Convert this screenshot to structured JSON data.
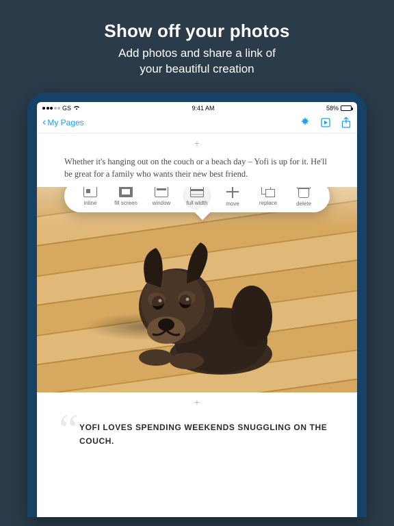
{
  "promo": {
    "title": "Show off your photos",
    "subtitle_l1": "Add photos and share a link of",
    "subtitle_l2": "your beautiful creation"
  },
  "statusbar": {
    "carrier": "GS",
    "time": "9:41 AM",
    "battery_pct": "58%"
  },
  "nav": {
    "back_label": "My Pages"
  },
  "body": {
    "paragraph": "Whether it's hanging out on the couch or a beach day – Yofi is up  for it. He'll be great for a family who wants their new best friend.",
    "quote": "YOFI LOVES SPENDING WEEKENDS SNUGGLING ON THE COUCH.",
    "add_glyph": "+"
  },
  "toolbar": {
    "items": [
      {
        "label": "inline"
      },
      {
        "label": "fill screen"
      },
      {
        "label": "window"
      },
      {
        "label": "full width"
      },
      {
        "label": "move"
      },
      {
        "label": "replace"
      },
      {
        "label": "delete"
      }
    ],
    "selected_index": 3
  },
  "icons": {
    "sparkle": "✦",
    "present": "⛶",
    "share": "⇪"
  }
}
